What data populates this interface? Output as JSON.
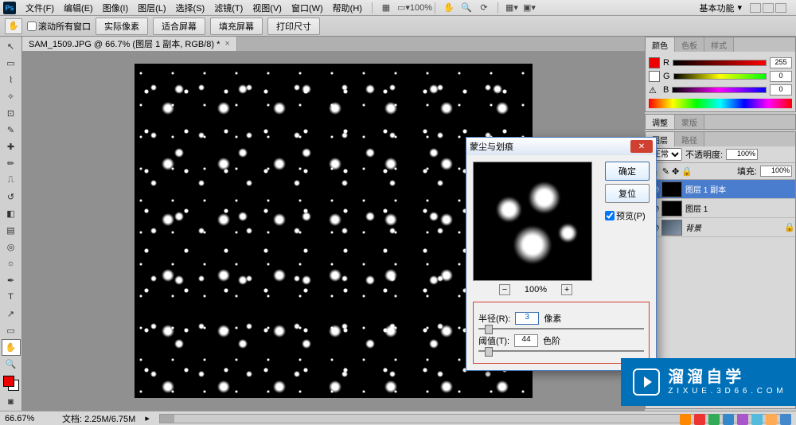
{
  "menu": {
    "items": [
      "文件(F)",
      "编辑(E)",
      "图像(I)",
      "图层(L)",
      "选择(S)",
      "滤镜(T)",
      "视图(V)",
      "窗口(W)",
      "帮助(H)"
    ],
    "zoom_pct": "100%",
    "workspace_label": "基本功能"
  },
  "options": {
    "scroll_all": "滚动所有窗口",
    "btns": [
      "实际像素",
      "适合屏幕",
      "填充屏幕",
      "打印尺寸"
    ]
  },
  "doc": {
    "tab_title": "SAM_1509.JPG @ 66.7% (图层 1 副本, RGB/8) *"
  },
  "color_panel": {
    "tabs": [
      "颜色",
      "色板",
      "样式"
    ],
    "r": "255",
    "g": "0",
    "b": "0"
  },
  "adjust_panel": {
    "tabs": [
      "调整",
      "蒙版"
    ]
  },
  "layers_panel": {
    "tabs": [
      "图层",
      "路径"
    ],
    "opacity_label": "不透明度:",
    "opacity_val": "100%",
    "fill_label": "填充:",
    "fill_val": "100%",
    "layers": [
      {
        "name": "图层 1 副本",
        "selected": true
      },
      {
        "name": "图层 1",
        "selected": false
      },
      {
        "name": "背景",
        "selected": false,
        "locked": true
      }
    ]
  },
  "dialog": {
    "title": "蒙尘与划痕",
    "ok": "确定",
    "reset": "复位",
    "preview": "预览(P)",
    "zoom": "100%",
    "radius_label": "半径(R):",
    "radius_val": "3",
    "radius_unit": "像素",
    "threshold_label": "阈值(T):",
    "threshold_val": "44",
    "threshold_unit": "色阶"
  },
  "status": {
    "zoom": "66.67%",
    "docinfo": "文档: 2.25M/6.75M"
  },
  "watermark": {
    "t1": "溜溜自学",
    "t2": "Z I X U E . 3 D 6 6 . C O M"
  }
}
